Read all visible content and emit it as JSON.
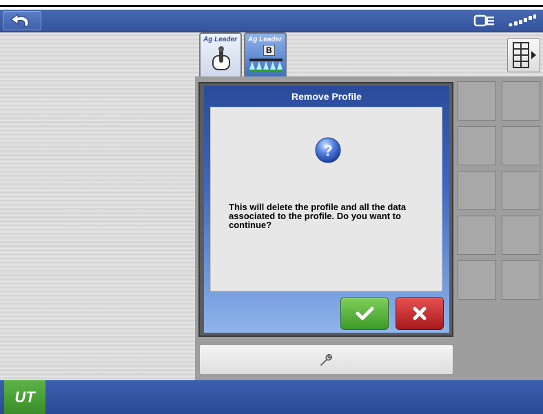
{
  "bottom_bar": {
    "app_label": "UT"
  },
  "tabs": [
    {
      "label": "Ag Leader"
    },
    {
      "label": "Ag Leader",
      "badge": "B"
    }
  ],
  "dialog": {
    "title": "Remove Profile",
    "message": "This will delete the profile and all the data associated to the profile. Do you want to continue?",
    "confirm_icon": "check-icon",
    "cancel_icon": "x-icon"
  },
  "colors": {
    "topbar": "#3f62ad",
    "dialog_title": "#2a4b9a",
    "confirm": "#4caf2f",
    "cancel": "#c82525",
    "ut_button": "#4aa336"
  }
}
